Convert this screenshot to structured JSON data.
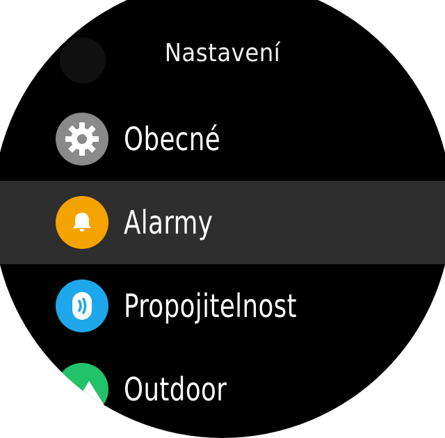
{
  "header": {
    "title": "Nastavení"
  },
  "menu": {
    "items": [
      {
        "label": "Obecné",
        "icon": "gear-icon",
        "color": "#8a8a8a",
        "selected": false
      },
      {
        "label": "Alarmy",
        "icon": "bell-icon",
        "color": "#f5a300",
        "selected": true
      },
      {
        "label": "Propojitelnost",
        "icon": "connectivity-icon",
        "color": "#1ea7ea",
        "selected": false
      },
      {
        "label": "Outdoor",
        "icon": "mountain-icon",
        "color": "#22c26a",
        "selected": false
      }
    ]
  },
  "colors": {
    "background": "#000000",
    "selected_row": "#2e2e2e",
    "text": "#ffffff"
  }
}
